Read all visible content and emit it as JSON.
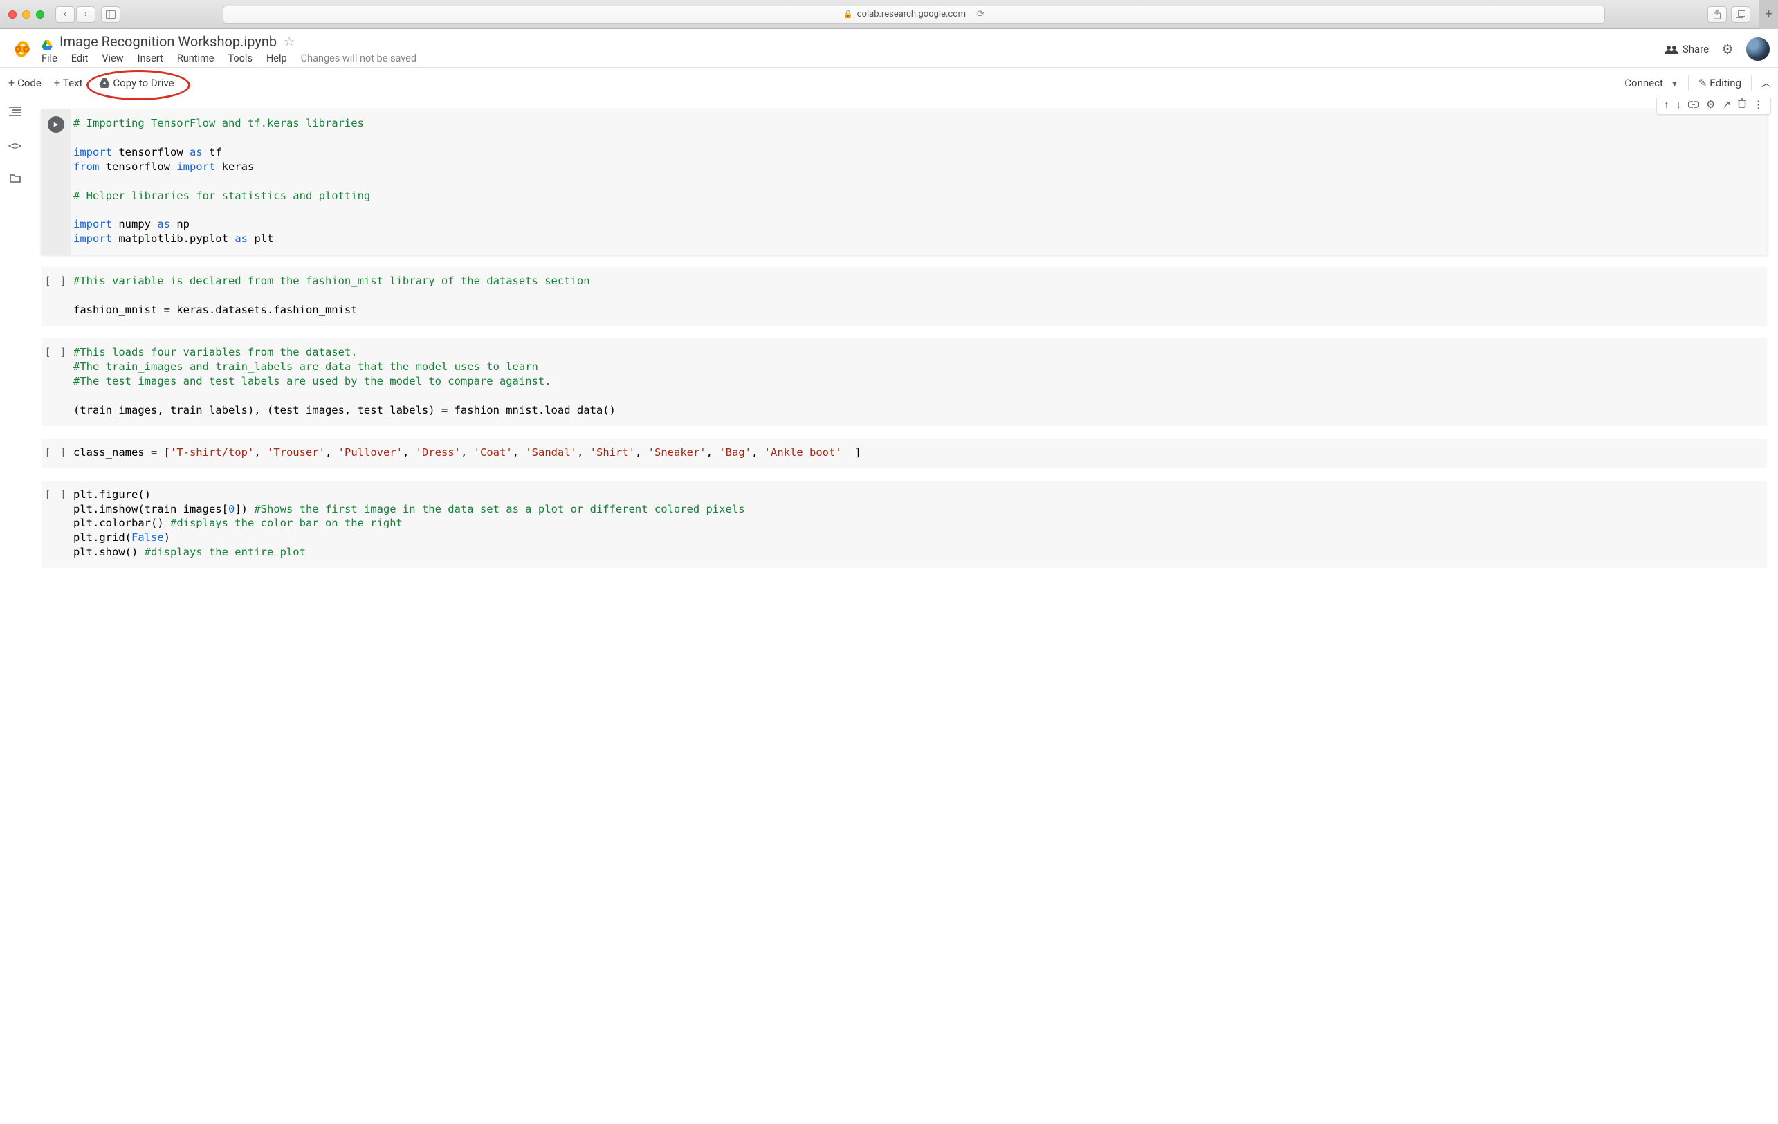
{
  "browser": {
    "url": "colab.research.google.com"
  },
  "header": {
    "title": "Image Recognition Workshop.ipynb",
    "menus": [
      "File",
      "Edit",
      "View",
      "Insert",
      "Runtime",
      "Tools",
      "Help"
    ],
    "status": "Changes will not be saved",
    "share_label": "Share"
  },
  "toolbar": {
    "code_label": "Code",
    "text_label": "Text",
    "copy_label": "Copy to Drive",
    "connect_label": "Connect",
    "editing_label": "Editing"
  },
  "cell_tools": {
    "up": "↑",
    "down": "↓",
    "link": "⊕",
    "settings": "⚙",
    "open": "↗",
    "delete": "🗑",
    "more": "⋮"
  },
  "cells": [
    {
      "html": "<span class='c'># Importing TensorFlow and tf.keras libraries</span>\n\n<span class='k'>import</span> tensorflow <span class='k'>as</span> tf\n<span class='k'>from</span> tensorflow <span class='k'>import</span> keras\n\n<span class='c'># Helper libraries for statistics and plotting</span>\n\n<span class='k'>import</span> numpy <span class='k'>as</span> np\n<span class='k'>import</span> matplotlib.pyplot <span class='k'>as</span> plt"
    },
    {
      "html": "<span class='c'>#This variable is declared from the fashion_mist library of the datasets section</span>\n\nfashion_mnist = keras.datasets.fashion_mnist"
    },
    {
      "html": "<span class='c'>#This loads four variables from the dataset.</span>\n<span class='c'>#The train_images and train_labels are data that the model uses to learn</span>\n<span class='c'>#The test_images and test_labels are used by the model to compare against.</span>\n\n(train_images, train_labels), (test_images, test_labels) = fashion_mnist.load_data()"
    },
    {
      "html": "class_names = [<span class='s'>'T-shirt/top'</span>, <span class='s'>'Trouser'</span>, <span class='s'>'Pullover'</span>, <span class='s'>'Dress'</span>, <span class='s'>'Coat'</span>, <span class='s'>'Sandal'</span>, <span class='s'>'Shirt'</span>, <span class='s'>'Sneaker'</span>, <span class='s'>'Bag'</span>, <span class='s'>'Ankle boot'</span>  ]"
    },
    {
      "html": "plt.figure()\nplt.imshow(train_images[<span class='m'>0</span>]) <span class='c'>#Shows the first image in the data set as a plot or different colored pixels</span>\nplt.colorbar() <span class='c'>#displays the color bar on the right</span>\nplt.grid(<span class='k'>False</span>)\nplt.show() <span class='c'>#displays the entire plot</span>"
    }
  ]
}
